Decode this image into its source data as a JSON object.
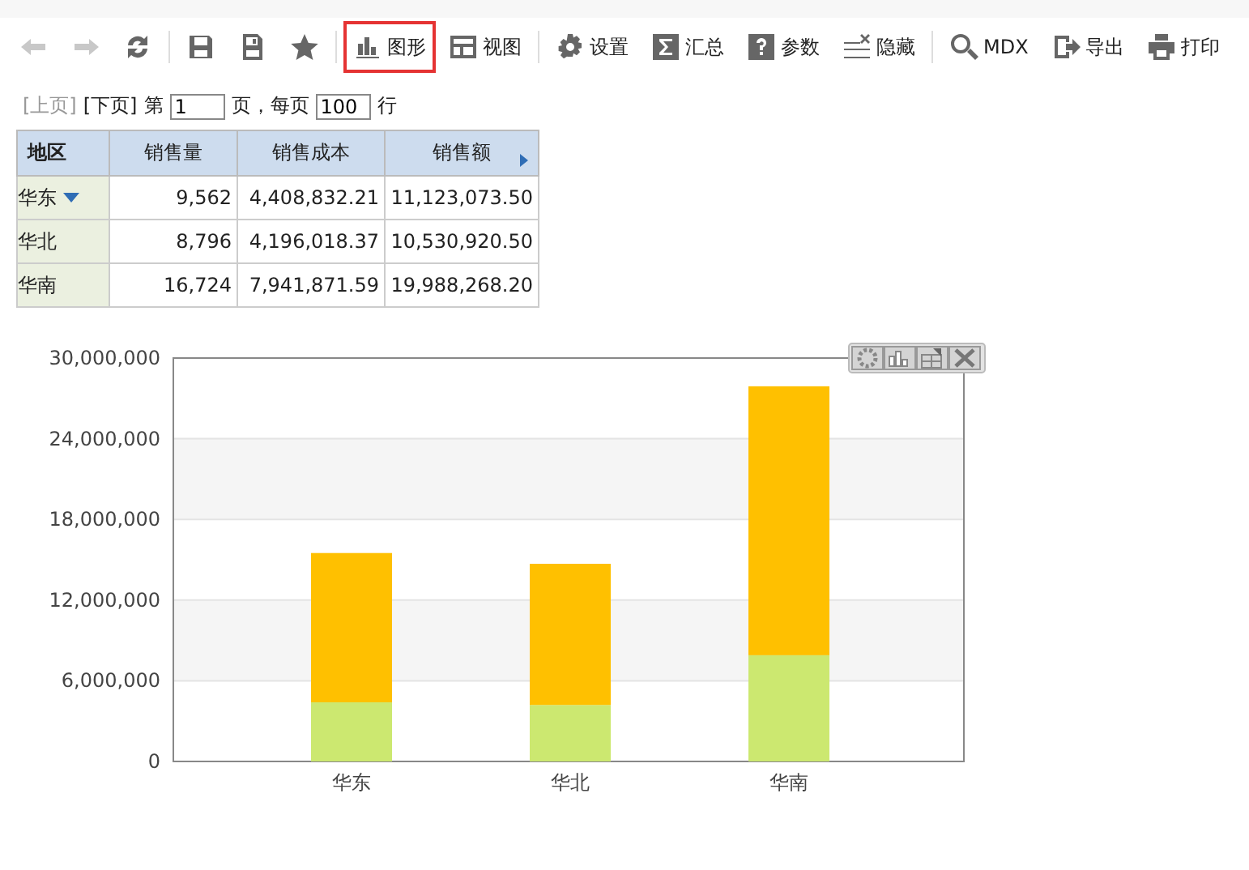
{
  "toolbar": [
    {
      "kind": "back",
      "disabled": true,
      "selected": false
    },
    {
      "kind": "forward",
      "disabled": true,
      "selected": false
    },
    {
      "kind": "refresh",
      "disabled": false,
      "selected": false,
      "sep_after": true
    },
    {
      "kind": "save",
      "disabled": false,
      "selected": false
    },
    {
      "kind": "save-as",
      "disabled": false,
      "selected": false
    },
    {
      "kind": "star",
      "disabled": false,
      "selected": false,
      "sep_after": true
    },
    {
      "kind": "chart",
      "label": "图形",
      "disabled": false,
      "selected": true
    },
    {
      "kind": "view",
      "label": "视图",
      "disabled": false,
      "selected": false,
      "sep_after": true
    },
    {
      "kind": "gear",
      "label": "设置",
      "disabled": false,
      "selected": false
    },
    {
      "kind": "sigma",
      "label": "汇总",
      "disabled": false,
      "selected": false
    },
    {
      "kind": "question",
      "label": "参数",
      "disabled": false,
      "selected": false
    },
    {
      "kind": "hide",
      "label": "隐藏",
      "disabled": false,
      "selected": false,
      "sep_after": true
    },
    {
      "kind": "search",
      "label": "MDX",
      "disabled": false,
      "selected": false
    },
    {
      "kind": "export",
      "label": "导出",
      "disabled": false,
      "selected": false
    },
    {
      "kind": "print",
      "label": "打印",
      "disabled": false,
      "selected": false
    }
  ],
  "pager": {
    "prev": {
      "label": "[上页]",
      "disabled": true
    },
    "next": {
      "label": "[下页]",
      "disabled": false
    },
    "page_prefix": "第",
    "page": "1",
    "page_suffix": "页，每页",
    "per_page": "100",
    "per_page_suffix": "行"
  },
  "table": {
    "columns": [
      "地区",
      "销售量",
      "销售成本",
      "销售额"
    ],
    "rows": [
      {
        "dropdown": true,
        "cells": [
          "华东",
          "9,562",
          "4,408,832.21",
          "11,123,073.50"
        ]
      },
      {
        "dropdown": false,
        "cells": [
          "华北",
          "8,796",
          "4,196,018.37",
          "10,530,920.50"
        ]
      },
      {
        "dropdown": false,
        "cells": [
          "华南",
          "16,724",
          "7,941,871.59",
          "19,988,268.20"
        ]
      }
    ]
  },
  "chart": {
    "chart_data": {
      "type": "bar",
      "stacked": true,
      "grid": true,
      "categories": [
        "华东",
        "华北",
        "华南"
      ],
      "series": [
        {
          "color": "#cce870",
          "values": [
            4400000,
            4200000,
            7900000
          ]
        },
        {
          "color": "#ffc000",
          "values": [
            11100000,
            10500000,
            20000000
          ]
        }
      ],
      "ylim": [
        0,
        30000000
      ],
      "yticks": [
        {
          "value": 0,
          "label": "0"
        },
        {
          "value": 6000000,
          "label": "6,000,000"
        },
        {
          "value": 12000000,
          "label": "12,000,000"
        },
        {
          "value": 18000000,
          "label": "18,000,000"
        },
        {
          "value": 24000000,
          "label": "24,000,000"
        },
        {
          "value": 30000000,
          "label": "30,000,000"
        }
      ]
    }
  }
}
